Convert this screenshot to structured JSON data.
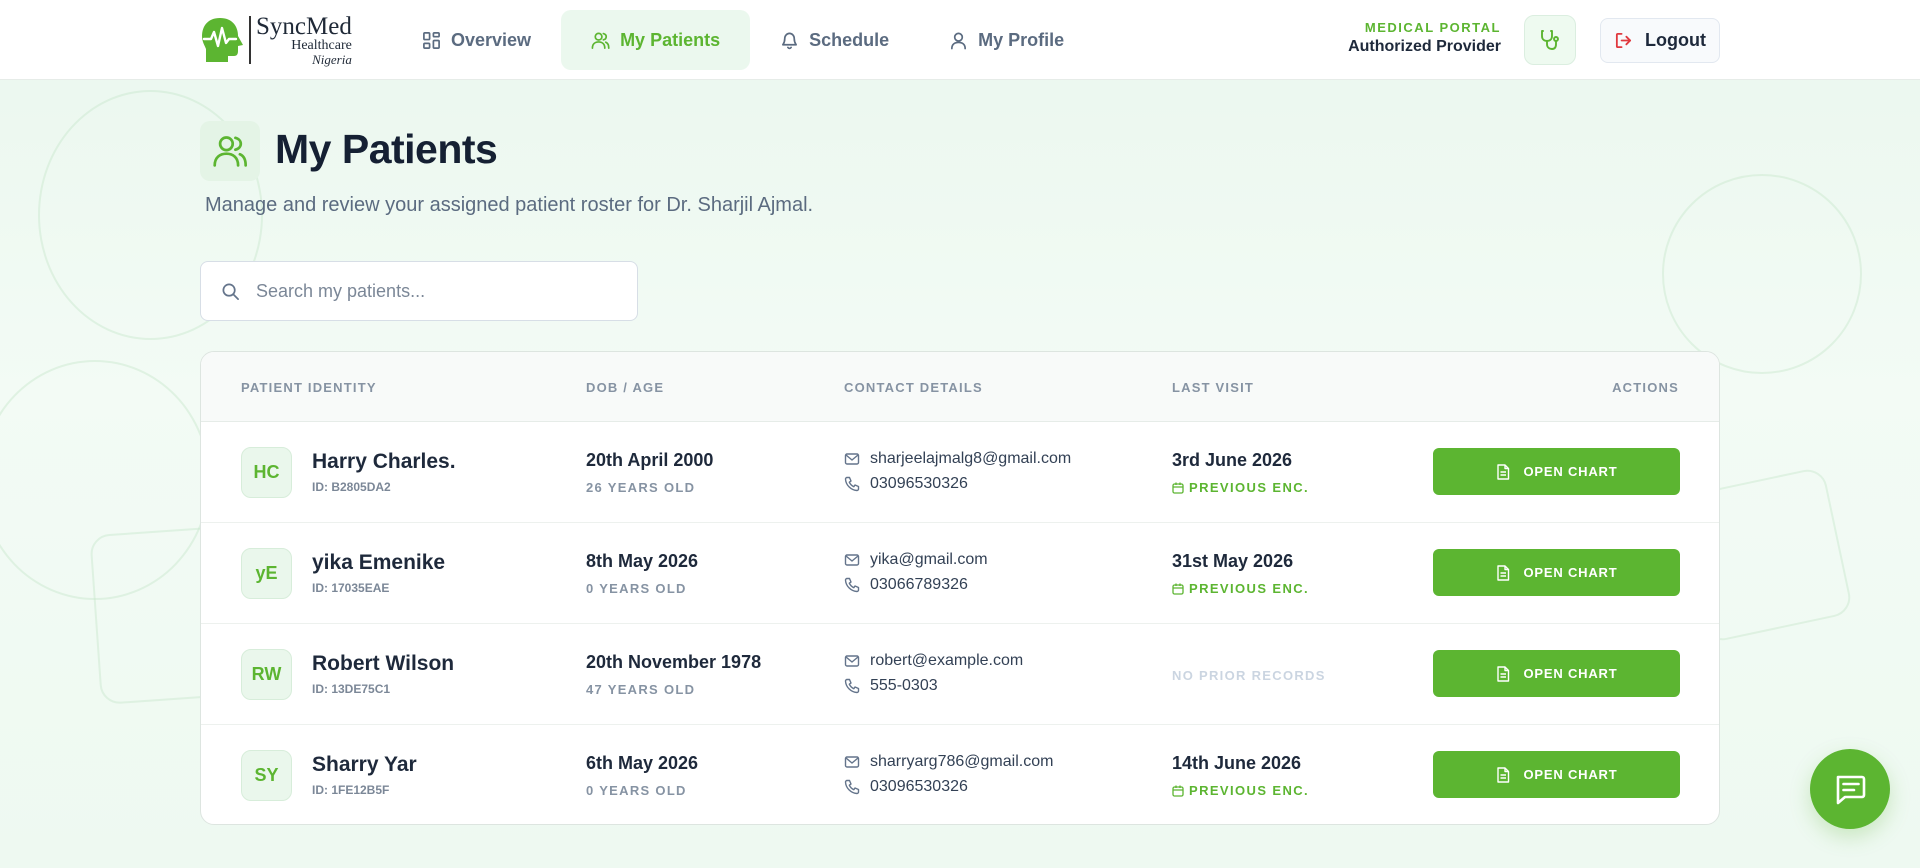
{
  "brand": {
    "name": "SyncMed",
    "subtitle": "Healthcare",
    "region": "Nigeria",
    "accent": "#5cb531"
  },
  "nav": {
    "items": [
      {
        "label": "Overview",
        "icon": "grid-icon",
        "active": false
      },
      {
        "label": "My Patients",
        "icon": "users-icon",
        "active": true
      },
      {
        "label": "Schedule",
        "icon": "bell-icon",
        "active": false
      },
      {
        "label": "My Profile",
        "icon": "user-icon",
        "active": false
      }
    ]
  },
  "portal": {
    "tag": "MEDICAL PORTAL",
    "role": "Authorized Provider",
    "logout_label": "Logout"
  },
  "page": {
    "title": "My Patients",
    "subtitle": "Manage and review your assigned patient roster for Dr. Sharjil Ajmal."
  },
  "search": {
    "placeholder": "Search my patients..."
  },
  "table": {
    "columns": [
      "PATIENT IDENTITY",
      "DOB / AGE",
      "CONTACT DETAILS",
      "LAST VISIT",
      "ACTIONS"
    ],
    "rows": [
      {
        "initials": "HC",
        "name": "Harry Charles.",
        "id": "ID: B2805DA2",
        "dob": "20th April 2000",
        "age": "26 YEARS OLD",
        "email": "sharjeelajmalg8@gmail.com",
        "phone": "03096530326",
        "last_visit": "3rd June 2026",
        "visit_tag": "PREVIOUS ENC.",
        "action": "OPEN CHART"
      },
      {
        "initials": "yE",
        "name": "yika Emenike",
        "id": "ID: 17035EAE",
        "dob": "8th May 2026",
        "age": "0 YEARS OLD",
        "email": "yika@gmail.com",
        "phone": "03066789326",
        "last_visit": "31st May 2026",
        "visit_tag": "PREVIOUS ENC.",
        "action": "OPEN CHART"
      },
      {
        "initials": "RW",
        "name": "Robert Wilson",
        "id": "ID: 13DE75C1",
        "dob": "20th November 1978",
        "age": "47 YEARS OLD",
        "email": "robert@example.com",
        "phone": "555-0303",
        "no_records": "NO PRIOR RECORDS",
        "action": "OPEN CHART"
      },
      {
        "initials": "SY",
        "name": "Sharry Yar",
        "id": "ID: 1FE12B5F",
        "dob": "6th May 2026",
        "age": "0 YEARS OLD",
        "email": "sharryarg786@gmail.com",
        "phone": "03096530326",
        "last_visit": "14th June 2026",
        "visit_tag": "PREVIOUS ENC.",
        "action": "OPEN CHART"
      }
    ]
  },
  "chat": {
    "icon": "chat-icon"
  }
}
